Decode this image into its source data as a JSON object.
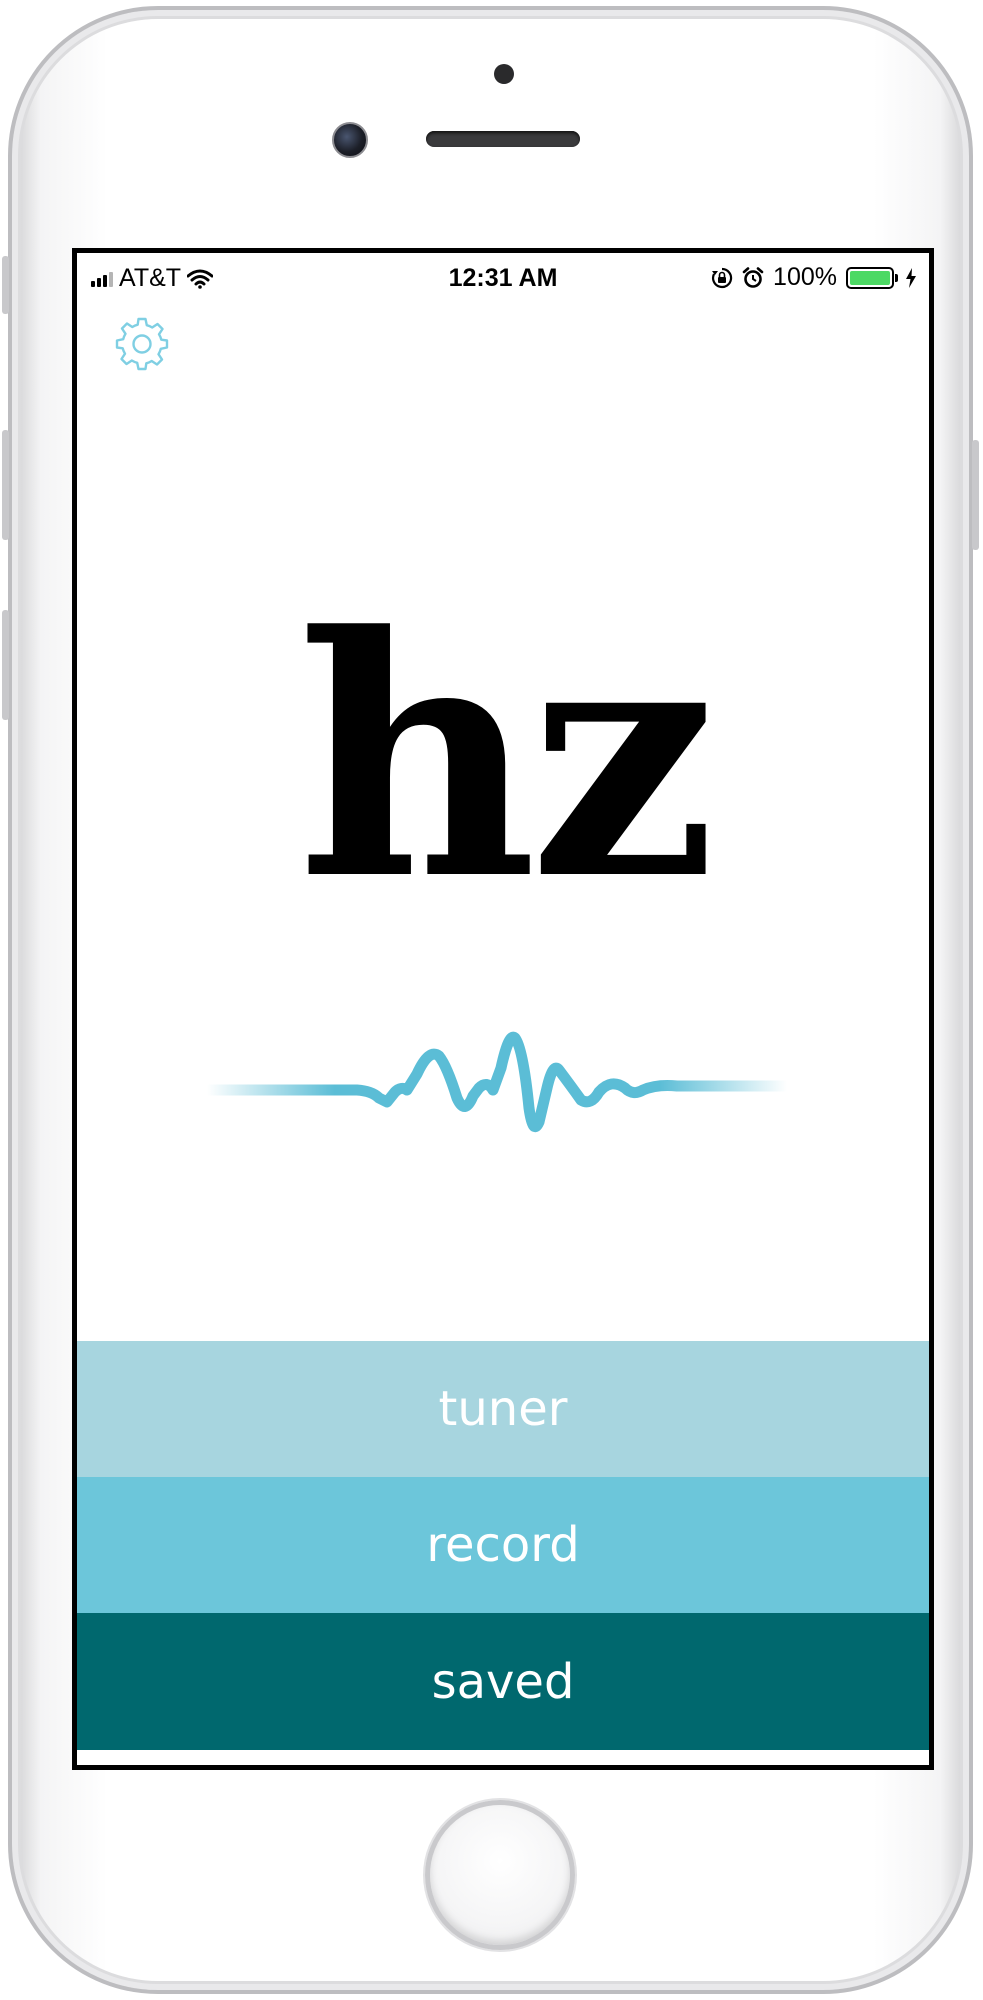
{
  "status_bar": {
    "carrier": "AT&T",
    "time": "12:31 AM",
    "battery_percent": "100%",
    "battery_level": 1.0,
    "icons": [
      "signal-icon",
      "wifi-icon",
      "lock-rotation-icon",
      "alarm-icon",
      "battery-icon",
      "charging-icon"
    ]
  },
  "header": {
    "settings_icon": "gear-icon"
  },
  "logo": {
    "text": "hz",
    "wave_icon": "sound-wave-icon"
  },
  "menu": {
    "items": [
      {
        "label": "tuner",
        "color": "#a7d5df"
      },
      {
        "label": "record",
        "color": "#6cc6da"
      },
      {
        "label": "saved",
        "color": "#00686e"
      }
    ]
  },
  "colors": {
    "accent": "#5bbdd6",
    "gear": "#7fcfe3",
    "text_on_buttons": "#ffffff"
  }
}
